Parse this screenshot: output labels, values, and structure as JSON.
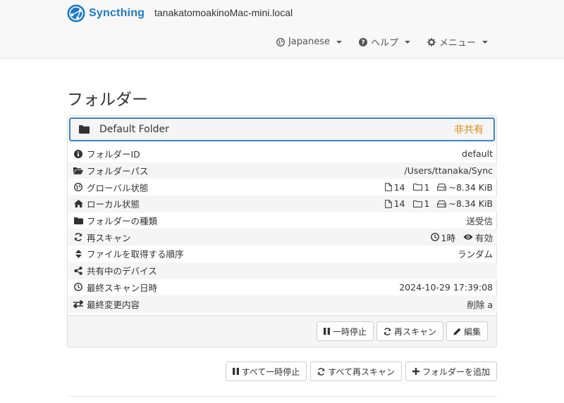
{
  "navbar": {
    "brand": "Syncthing",
    "hostname": "tanakatomoakinoMac-mini.local",
    "menus": [
      {
        "label": "Japanese",
        "icon": "globe-icon"
      },
      {
        "label": "ヘルプ",
        "icon": "question-circle-icon"
      },
      {
        "label": "メニュー",
        "icon": "cog-icon"
      }
    ]
  },
  "page": {
    "title": "フォルダー"
  },
  "folder": {
    "name": "Default Folder",
    "status": "非共有",
    "status_color": "#e08a14",
    "rows": [
      {
        "label": "フォルダーID",
        "icon": "info-circle-icon",
        "value": "default"
      },
      {
        "label": "フォルダーパス",
        "icon": "folder-open-icon",
        "value": "/Users/ttanaka/Sync"
      },
      {
        "label": "グローバル状態",
        "icon": "globe-icon",
        "files": "14",
        "dirs": "1",
        "size": "~8.34 KiB"
      },
      {
        "label": "ローカル状態",
        "icon": "home-icon",
        "files": "14",
        "dirs": "1",
        "size": "~8.34 KiB"
      },
      {
        "label": "フォルダーの種類",
        "icon": "folder-icon",
        "value": "送受信"
      },
      {
        "label": "再スキャン",
        "icon": "refresh-icon",
        "interval": "1時",
        "watch": "有効"
      },
      {
        "label": "ファイルを取得する順序",
        "icon": "sort-icon",
        "value": "ランダム"
      },
      {
        "label": "共有中のデバイス",
        "icon": "share-alt-icon",
        "value": ""
      },
      {
        "label": "最終スキャン日時",
        "icon": "clock-icon",
        "value": "2024-10-29 17:39:08"
      },
      {
        "label": "最終変更内容",
        "icon": "exchange-icon",
        "value": "削除 a"
      }
    ],
    "buttons": {
      "pause": "一時停止",
      "rescan": "再スキャン",
      "edit": "編集"
    }
  },
  "global_buttons": {
    "pause_all": "すべて一時停止",
    "rescan_all": "すべて再スキャン",
    "add_folder": "フォルダーを追加"
  },
  "colors": {
    "accent": "#3a82d8",
    "brand": "#1c7ac9"
  }
}
